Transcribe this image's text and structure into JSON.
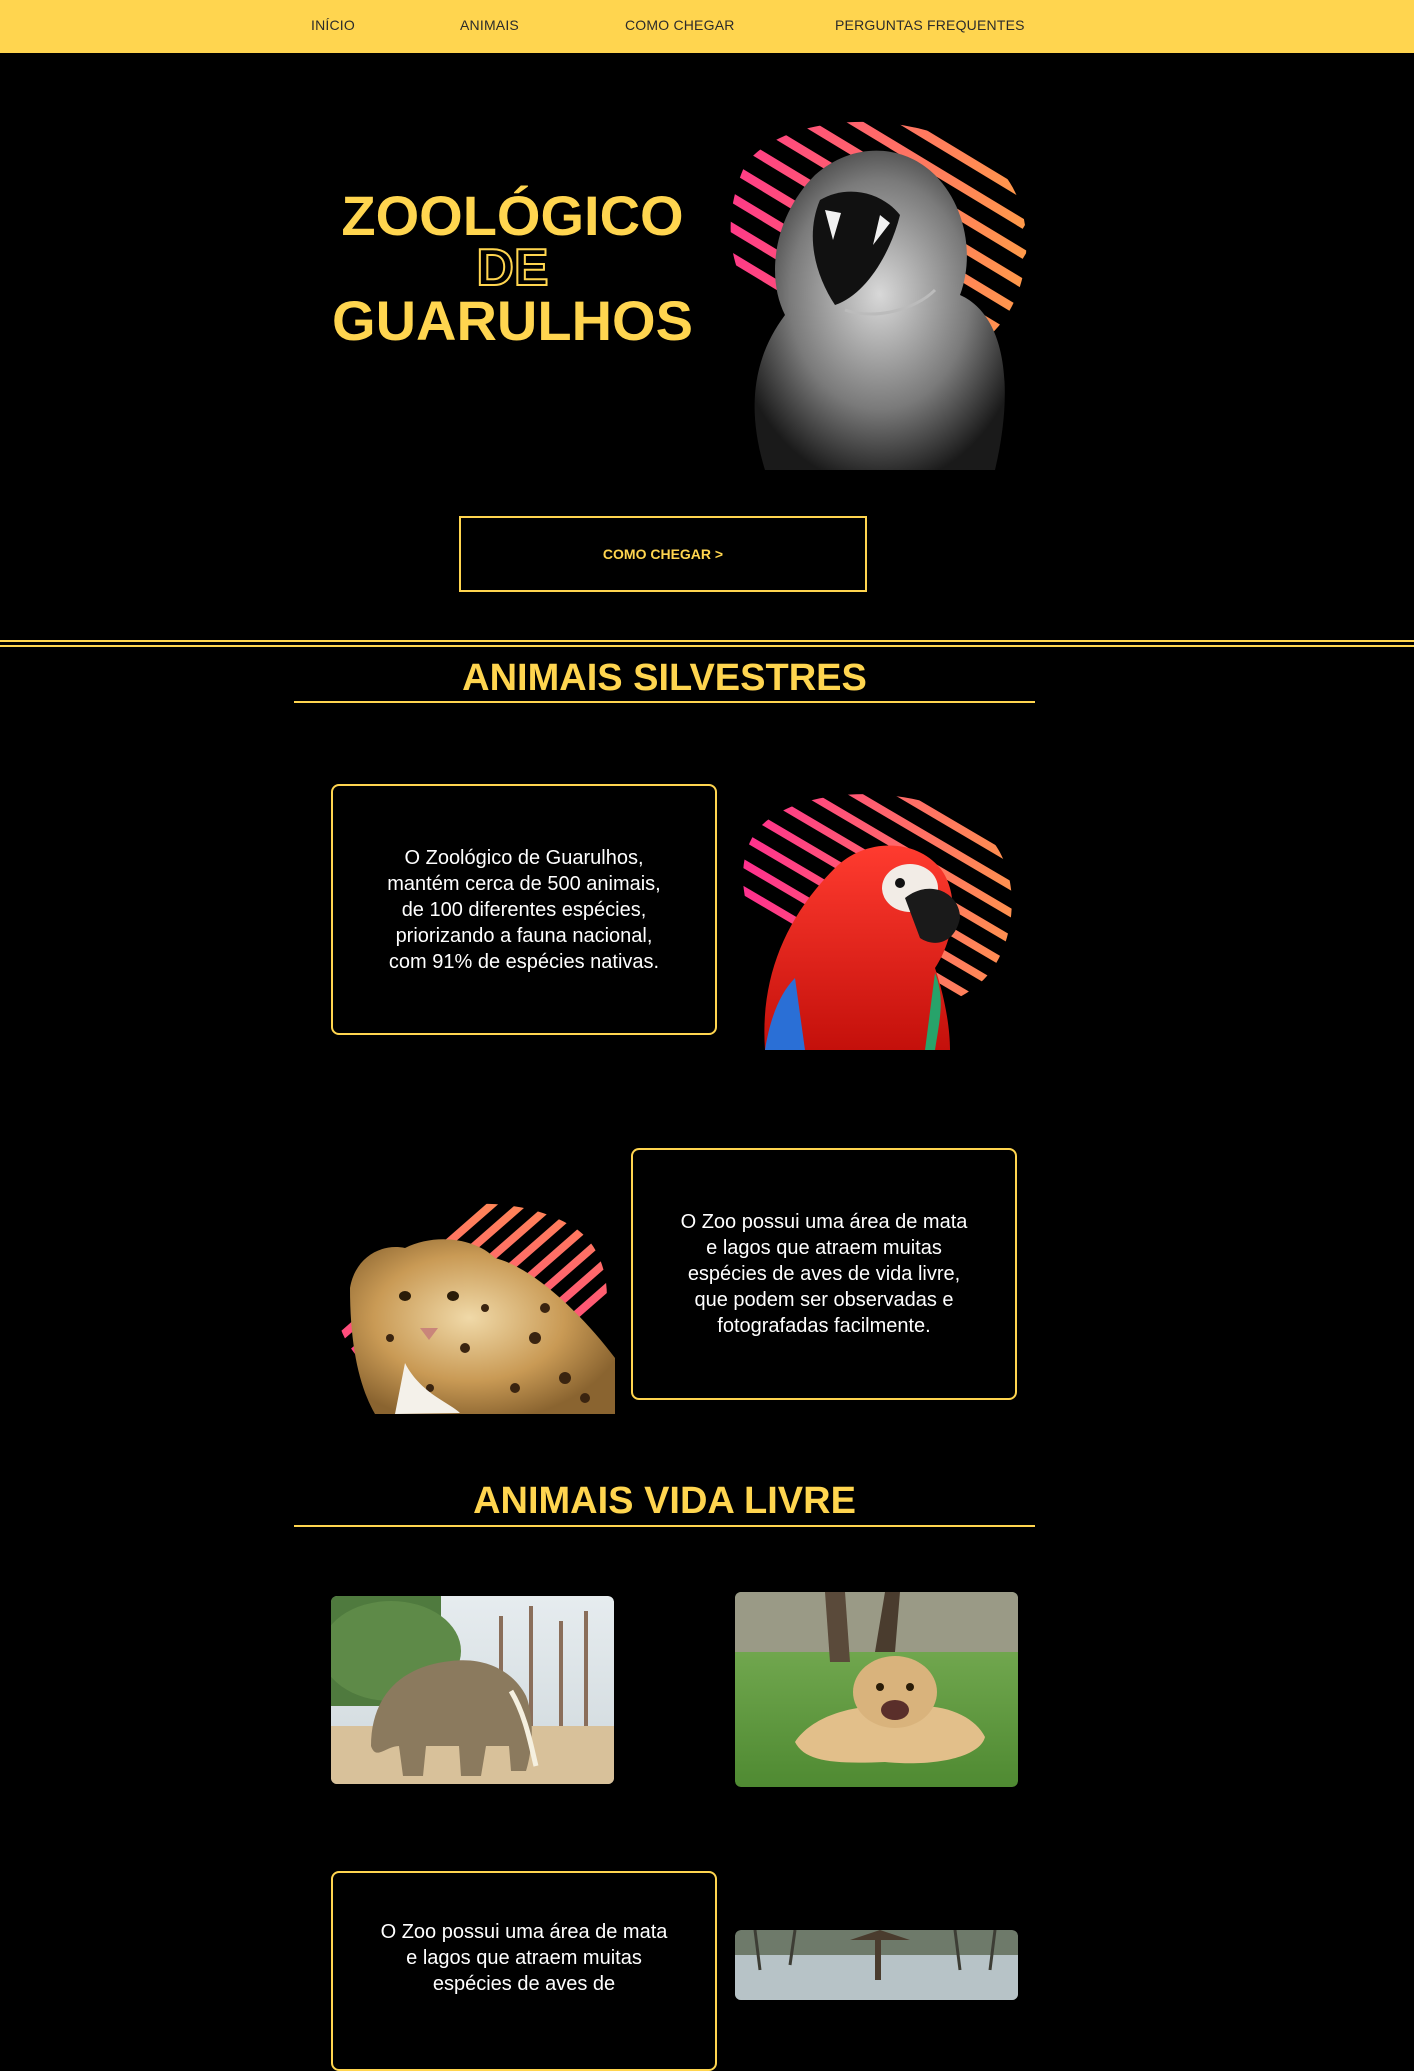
{
  "nav": {
    "items": [
      "INÍCIO",
      "ANIMAIS",
      "COMO CHEGAR",
      "PERGUNTAS FREQUENTES"
    ]
  },
  "hero": {
    "title_line1": "ZOOLÓGICO",
    "title_line2": "DE",
    "title_line3": "GUARULHOS",
    "cta_label": "COMO CHEGAR >"
  },
  "sections": {
    "silvestres_title": "ANIMAIS SILVESTRES",
    "vida_livre_title": "ANIMAIS VIDA LIVRE"
  },
  "cards": {
    "card1": "O Zoológico de Guarulhos, mantém cerca de 500 animais, de 100 diferentes espécies, priorizando a fauna nacional, com 91% de espécies nativas.",
    "card2": "O Zoo possui uma área de mata e lagos que atraem muitas espécies de aves de vida livre, que podem ser observadas e fotografadas facilmente.",
    "card3": "O Zoo possui uma área de mata e lagos que atraem muitas espécies de aves de"
  },
  "colors": {
    "accent": "#FFD54F",
    "background": "#000000",
    "stripe_pink": "#FF2D95",
    "stripe_orange": "#FF8A4A"
  },
  "icons": {
    "tiger": "tiger-photo",
    "parrot": "macaw-photo",
    "jaguar": "jaguar-photo",
    "elephant": "elephant-photo",
    "lion": "lion-cub-photo",
    "lake": "lake-photo"
  }
}
